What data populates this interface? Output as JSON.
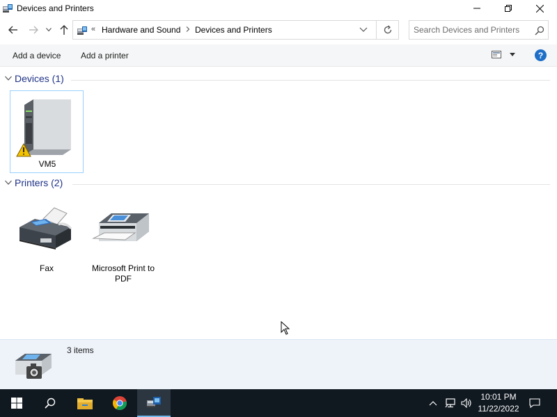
{
  "window": {
    "title": "Devices and Printers",
    "controls": {
      "minimize": "minimize",
      "restore": "restore",
      "close": "close"
    }
  },
  "address": {
    "overflow": "«",
    "crumbs": [
      "Hardware and Sound",
      "Devices and Printers"
    ],
    "search_placeholder": "Search Devices and Printers"
  },
  "commands": {
    "add_device": "Add a device",
    "add_printer": "Add a printer",
    "help": "?"
  },
  "groups": {
    "devices": {
      "title": "Devices (1)",
      "items": [
        {
          "label": "VM5",
          "icon": "computer-warning-icon"
        }
      ]
    },
    "printers": {
      "title": "Printers (2)",
      "items": [
        {
          "label": "Fax",
          "icon": "fax-icon"
        },
        {
          "label": "Microsoft Print to PDF",
          "icon": "printer-icon"
        }
      ]
    }
  },
  "details": {
    "count": "3 items"
  },
  "taskbar": {
    "time": "10:01 PM",
    "date": "11/22/2022",
    "accent": "#76b9ed"
  }
}
